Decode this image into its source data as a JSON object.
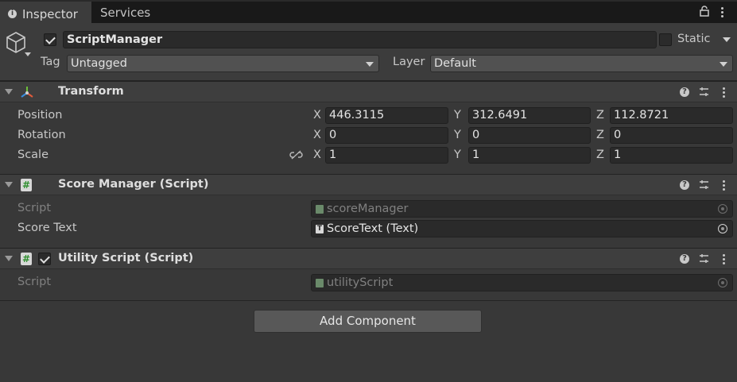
{
  "tabs": [
    {
      "label": "Inspector",
      "active": true
    },
    {
      "label": "Services",
      "active": false
    }
  ],
  "header": {
    "object_name": "ScriptManager",
    "active": true,
    "static_label": "Static",
    "static_checked": false,
    "tag_label": "Tag",
    "tag_value": "Untagged",
    "layer_label": "Layer",
    "layer_value": "Default"
  },
  "transform": {
    "title": "Transform",
    "rows": [
      {
        "label": "Position",
        "x": "446.3115",
        "y": "312.6491",
        "z": "112.8721"
      },
      {
        "label": "Rotation",
        "x": "0",
        "y": "0",
        "z": "0"
      },
      {
        "label": "Scale",
        "x": "1",
        "y": "1",
        "z": "1"
      }
    ],
    "axis_labels": {
      "x": "X",
      "y": "Y",
      "z": "Z"
    }
  },
  "score_manager": {
    "title": "Score Manager (Script)",
    "script_label": "Script",
    "script_value": "scoreManager",
    "score_text_label": "Score Text",
    "score_text_value": "ScoreText (Text)"
  },
  "utility_script": {
    "title": "Utility Script (Script)",
    "enabled": true,
    "script_label": "Script",
    "script_value": "utilityScript"
  },
  "add_component_label": "Add Component",
  "colors": {
    "background": "#383838",
    "tab_bar": "#191919",
    "field_bg": "#2a2a2a",
    "script_icon_green": "#2f8f2f"
  }
}
